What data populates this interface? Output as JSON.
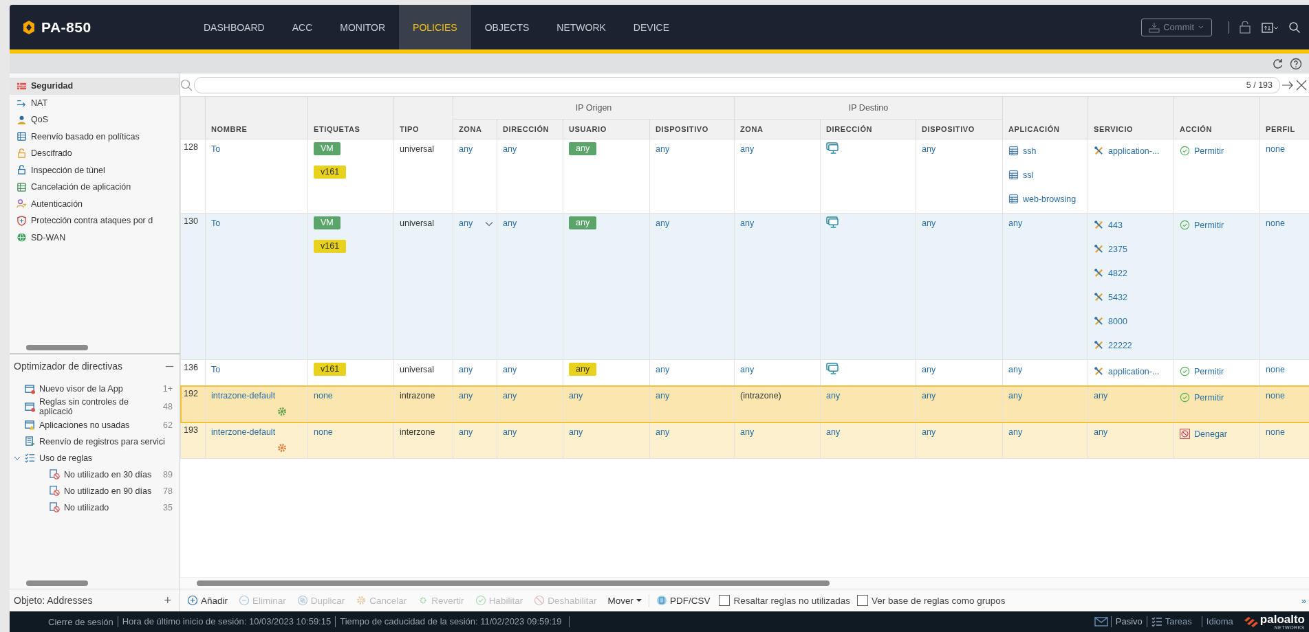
{
  "brand": {
    "name": "PA-850"
  },
  "nav": [
    {
      "label": "DASHBOARD",
      "selected": false
    },
    {
      "label": "ACC",
      "selected": false
    },
    {
      "label": "MONITOR",
      "selected": false
    },
    {
      "label": "POLICIES",
      "selected": true
    },
    {
      "label": "OBJECTS",
      "selected": false
    },
    {
      "label": "NETWORK",
      "selected": false
    },
    {
      "label": "DEVICE",
      "selected": false
    }
  ],
  "commit": {
    "label": "Commit",
    "disabled": true
  },
  "policies": [
    {
      "label": "Seguridad",
      "selected": true
    },
    {
      "label": "NAT",
      "selected": false
    },
    {
      "label": "QoS",
      "selected": false
    },
    {
      "label": "Reenvío basado en políticas",
      "selected": false
    },
    {
      "label": "Descifrado",
      "selected": false
    },
    {
      "label": "Inspección de túnel",
      "selected": false
    },
    {
      "label": "Cancelación de aplicación",
      "selected": false
    },
    {
      "label": "Autenticación",
      "selected": false
    },
    {
      "label": "Protección contra ataques por d",
      "selected": false
    },
    {
      "label": "SD-WAN",
      "selected": false
    }
  ],
  "optimizer": {
    "title": "Optimizador de directivas",
    "items": [
      {
        "label": "Nuevo visor de la App",
        "count": "1+"
      },
      {
        "label": "Reglas sin controles de aplicació",
        "count": "48"
      },
      {
        "label": "Aplicaciones no usadas",
        "count": "62"
      },
      {
        "label": "Reenvío de registros para servici"
      },
      {
        "label": "Uso de reglas",
        "expanded": true,
        "children": [
          {
            "label": "No utilizado en 30 días",
            "count": "89"
          },
          {
            "label": "No utilizado en 90 días",
            "count": "78"
          },
          {
            "label": "No utilizado",
            "count": "35"
          }
        ]
      }
    ]
  },
  "object_panel": {
    "label": "Objeto: Addresses",
    "add": "+"
  },
  "search": {
    "count": "5 / 193"
  },
  "table": {
    "headers": [
      {
        "label": "NOMBRE"
      },
      {
        "label": "ETIQUETAS"
      },
      {
        "label": "TIPO"
      },
      {
        "label": "IP Origen",
        "columns": [
          {
            "label": "ZONA"
          },
          {
            "label": "DIRECCIÓN"
          },
          {
            "label": "USUARIO"
          },
          {
            "label": "DISPOSITIVO"
          }
        ]
      },
      {
        "label": "IP Destino",
        "columns": [
          {
            "label": "ZONA"
          },
          {
            "label": "DIRECCIÓN"
          },
          {
            "label": "DISPOSITIVO"
          }
        ]
      },
      {
        "label": "APLICACIÓN"
      },
      {
        "label": "SERVICIO"
      },
      {
        "label": "ACCIÓN"
      },
      {
        "label": "PERFIL"
      }
    ],
    "rows": [
      {
        "index": "128",
        "selected": false,
        "highlighted": false,
        "predefined": false,
        "cells": [
          [
            {
              "kind": "link",
              "text": "To"
            }
          ],
          [
            {
              "kind": "tag",
              "text": "VM",
              "color": "#5ba56b"
            },
            {
              "kind": "tag",
              "text": "v161",
              "color": "#e8d21d"
            }
          ],
          [
            {
              "kind": "text",
              "text": "universal"
            }
          ],
          [
            {
              "kind": "link",
              "text": "any"
            }
          ],
          [
            {
              "kind": "link",
              "text": "any"
            }
          ],
          [
            {
              "kind": "tag",
              "text": "any",
              "color": "#5ba56b"
            }
          ],
          [
            {
              "kind": "link",
              "text": "any"
            }
          ],
          [
            {
              "kind": "link",
              "text": "any"
            }
          ],
          [
            {
              "kind": "host"
            }
          ],
          [
            {
              "kind": "link",
              "text": "any"
            }
          ],
          [
            {
              "kind": "app",
              "text": "ssh"
            },
            {
              "kind": "app",
              "text": "ssl"
            },
            {
              "kind": "app",
              "text": "web-browsing"
            }
          ],
          [
            {
              "kind": "service",
              "text": "application-..."
            }
          ],
          [
            {
              "kind": "allow",
              "text": "Permitir"
            }
          ],
          [
            {
              "kind": "link",
              "text": "none"
            }
          ]
        ]
      },
      {
        "index": "130",
        "selected": false,
        "highlighted": true,
        "predefined": false,
        "cells": [
          [
            {
              "kind": "link",
              "text": "To"
            }
          ],
          [
            {
              "kind": "tag",
              "text": "VM",
              "color": "#5ba56b"
            },
            {
              "kind": "tag",
              "text": "v161",
              "color": "#e8d21d"
            }
          ],
          [
            {
              "kind": "text",
              "text": "universal"
            }
          ],
          [
            {
              "kind": "link",
              "text": "any"
            },
            {
              "kind": "caret"
            }
          ],
          [
            {
              "kind": "link",
              "text": "any"
            }
          ],
          [
            {
              "kind": "tag",
              "text": "any",
              "color": "#5ba56b"
            }
          ],
          [
            {
              "kind": "link",
              "text": "any"
            }
          ],
          [
            {
              "kind": "link",
              "text": "any"
            }
          ],
          [
            {
              "kind": "host"
            }
          ],
          [
            {
              "kind": "link",
              "text": "any"
            }
          ],
          [
            {
              "kind": "link",
              "text": "any"
            }
          ],
          [
            {
              "kind": "service",
              "text": "443"
            },
            {
              "kind": "service",
              "text": "2375"
            },
            {
              "kind": "service",
              "text": "4822"
            },
            {
              "kind": "service",
              "text": "5432"
            },
            {
              "kind": "service",
              "text": "8000"
            },
            {
              "kind": "service",
              "text": "22222"
            }
          ],
          [
            {
              "kind": "allow",
              "text": "Permitir"
            }
          ],
          [
            {
              "kind": "link",
              "text": "none"
            }
          ]
        ]
      },
      {
        "index": "136",
        "selected": false,
        "highlighted": false,
        "predefined": false,
        "cells": [
          [
            {
              "kind": "link",
              "text": "To"
            }
          ],
          [
            {
              "kind": "tag",
              "text": "v161",
              "color": "#e8d21d"
            }
          ],
          [
            {
              "kind": "text",
              "text": "universal"
            }
          ],
          [
            {
              "kind": "link",
              "text": "any"
            }
          ],
          [
            {
              "kind": "link",
              "text": "any"
            }
          ],
          [
            {
              "kind": "tag",
              "text": "any",
              "color": "#e8d21d"
            }
          ],
          [
            {
              "kind": "link",
              "text": "any"
            }
          ],
          [
            {
              "kind": "link",
              "text": "any"
            }
          ],
          [
            {
              "kind": "host"
            }
          ],
          [
            {
              "kind": "link",
              "text": "any"
            }
          ],
          [
            {
              "kind": "link",
              "text": "any"
            }
          ],
          [
            {
              "kind": "service",
              "text": "application-..."
            }
          ],
          [
            {
              "kind": "allow",
              "text": "Permitir"
            }
          ],
          [
            {
              "kind": "link",
              "text": "none"
            }
          ]
        ]
      },
      {
        "index": "192",
        "selected": true,
        "highlighted": false,
        "predefined": true,
        "cells": [
          [
            {
              "kind": "link",
              "text": "intrazone-default"
            },
            {
              "kind": "gear",
              "color": "#5a9e4a"
            }
          ],
          [
            {
              "kind": "link",
              "text": "none"
            }
          ],
          [
            {
              "kind": "text",
              "text": "intrazone"
            }
          ],
          [
            {
              "kind": "link",
              "text": "any"
            }
          ],
          [
            {
              "kind": "link",
              "text": "any"
            }
          ],
          [
            {
              "kind": "link",
              "text": "any"
            }
          ],
          [
            {
              "kind": "link",
              "text": "any"
            }
          ],
          [
            {
              "kind": "text",
              "text": "(intrazone)"
            }
          ],
          [
            {
              "kind": "link",
              "text": "any"
            }
          ],
          [
            {
              "kind": "link",
              "text": "any"
            }
          ],
          [
            {
              "kind": "link",
              "text": "any"
            }
          ],
          [
            {
              "kind": "link",
              "text": "any"
            }
          ],
          [
            {
              "kind": "allow",
              "text": "Permitir"
            }
          ],
          [
            {
              "kind": "link",
              "text": "none"
            }
          ]
        ]
      },
      {
        "index": "193",
        "selected": false,
        "highlighted": false,
        "predefined": true,
        "cells": [
          [
            {
              "kind": "link",
              "text": "interzone-default"
            },
            {
              "kind": "gear",
              "color": "#e07b39"
            }
          ],
          [
            {
              "kind": "link",
              "text": "none"
            }
          ],
          [
            {
              "kind": "text",
              "text": "interzone"
            }
          ],
          [
            {
              "kind": "link",
              "text": "any"
            }
          ],
          [
            {
              "kind": "link",
              "text": "any"
            }
          ],
          [
            {
              "kind": "link",
              "text": "any"
            }
          ],
          [
            {
              "kind": "link",
              "text": "any"
            }
          ],
          [
            {
              "kind": "link",
              "text": "any"
            }
          ],
          [
            {
              "kind": "link",
              "text": "any"
            }
          ],
          [
            {
              "kind": "link",
              "text": "any"
            }
          ],
          [
            {
              "kind": "link",
              "text": "any"
            }
          ],
          [
            {
              "kind": "link",
              "text": "any"
            }
          ],
          [
            {
              "kind": "deny",
              "text": "Denegar"
            }
          ],
          [
            {
              "kind": "link",
              "text": "none"
            }
          ]
        ]
      }
    ]
  },
  "toolbar": [
    {
      "kind": "button",
      "label": "Añadir",
      "disabled": false
    },
    {
      "kind": "button",
      "label": "Eliminar",
      "disabled": true
    },
    {
      "kind": "button",
      "label": "Duplicar",
      "disabled": true
    },
    {
      "kind": "button",
      "label": "Cancelar",
      "disabled": true
    },
    {
      "kind": "button",
      "label": "Revertir",
      "disabled": true
    },
    {
      "kind": "button",
      "label": "Habilitar",
      "disabled": true
    },
    {
      "kind": "button",
      "label": "Deshabilitar",
      "disabled": true
    },
    {
      "kind": "menu",
      "label": "Mover",
      "disabled": false
    },
    {
      "kind": "button",
      "label": "PDF/CSV",
      "disabled": false
    },
    {
      "kind": "checkbox",
      "label": "Resaltar reglas no utilizadas",
      "checked": false
    },
    {
      "kind": "checkbox",
      "label": "Ver base de reglas como grupos",
      "checked": false
    }
  ],
  "toolbar_more": "»",
  "status": {
    "logout": "Cierre de sesión",
    "last_login": "Hora de último inicio de sesión: 10/03/2023 10:59:15",
    "expiry": "Tiempo de caducidad de la sesión: 11/02/2023 09:59:19",
    "mode": "Pasivo",
    "tasks": "Tareas",
    "language": "Idioma",
    "logo": "paloalto",
    "logo_sub": "NETWORKS"
  }
}
